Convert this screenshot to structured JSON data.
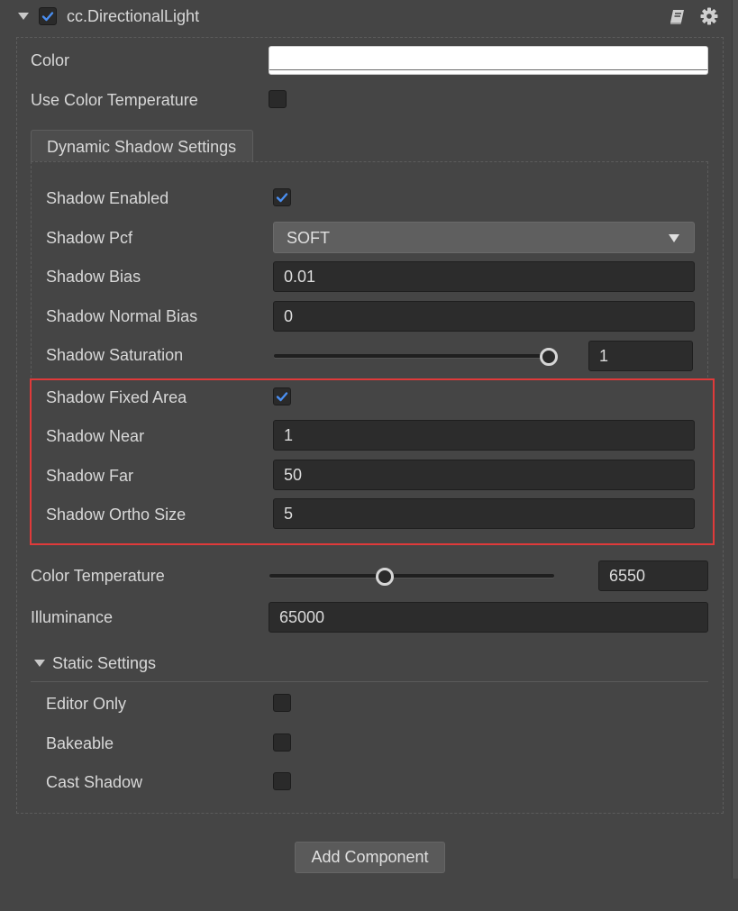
{
  "component": {
    "title": "cc.DirectionalLight",
    "enabled": true
  },
  "icons": {
    "collapse": "triangle-down-icon",
    "help": "book-icon",
    "settings": "gear-icon",
    "checkmark": "checkmark-icon",
    "dropdown": "triangle-down-icon"
  },
  "colors": {
    "panel_bg": "#454545",
    "input_bg": "#2c2c2c",
    "accent_check": "#4a8ef0",
    "highlight_border": "#e03a3a",
    "color_value": "#ffffff"
  },
  "props": {
    "color": {
      "label": "Color",
      "value": "#ffffff"
    },
    "use_color_temperature": {
      "label": "Use Color Temperature",
      "checked": false
    },
    "dynamic_shadow_tab": "Dynamic Shadow Settings",
    "shadow_enabled": {
      "label": "Shadow Enabled",
      "checked": true
    },
    "shadow_pcf": {
      "label": "Shadow Pcf",
      "value": "SOFT"
    },
    "shadow_bias": {
      "label": "Shadow Bias",
      "value": "0.01"
    },
    "shadow_normal_bias": {
      "label": "Shadow Normal Bias",
      "value": "0"
    },
    "shadow_saturation": {
      "label": "Shadow Saturation",
      "value": "1",
      "slider_fraction": 1.0
    },
    "shadow_fixed_area": {
      "label": "Shadow Fixed Area",
      "checked": true
    },
    "shadow_near": {
      "label": "Shadow Near",
      "value": "1"
    },
    "shadow_far": {
      "label": "Shadow Far",
      "value": "50"
    },
    "shadow_ortho_size": {
      "label": "Shadow Ortho Size",
      "value": "5"
    },
    "color_temperature": {
      "label": "Color Temperature",
      "value": "6550",
      "slider_fraction": 0.4
    },
    "illuminance": {
      "label": "Illuminance",
      "value": "65000"
    }
  },
  "static_settings": {
    "title": "Static Settings",
    "editor_only": {
      "label": "Editor Only",
      "checked": false
    },
    "bakeable": {
      "label": "Bakeable",
      "checked": false
    },
    "cast_shadow": {
      "label": "Cast Shadow",
      "checked": false
    }
  },
  "add_component_label": "Add Component"
}
